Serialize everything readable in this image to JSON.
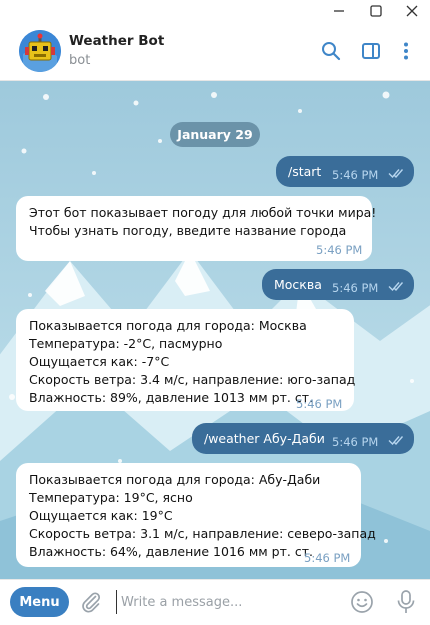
{
  "chat": {
    "title": "Weather Bot",
    "subtitle": "bot"
  },
  "date_separator": "January 29",
  "messages": [
    {
      "direction": "outgoing",
      "lines": [
        "/start"
      ],
      "time": "5:46 PM",
      "read": true
    },
    {
      "direction": "incoming",
      "lines": [
        "Этот бот показывает погоду для любой точки мира!",
        "Чтобы узнать погоду, введите название города"
      ],
      "time": "5:46 PM"
    },
    {
      "direction": "outgoing",
      "lines": [
        "Москва"
      ],
      "time": "5:46 PM",
      "read": true
    },
    {
      "direction": "incoming",
      "lines": [
        "Показывается погода для города: Москва",
        "Температура: -2°C, пасмурно",
        "Ощущается как: -7°C",
        "Скорость ветра: 3.4 м/с, направление: юго-запад",
        "Влажность: 89%, давление 1013 мм рт. ст."
      ],
      "time": "5:46 PM"
    },
    {
      "direction": "outgoing",
      "lines": [
        "/weather Абу-Даби"
      ],
      "time": "5:46 PM",
      "read": true
    },
    {
      "direction": "incoming",
      "lines": [
        "Показывается погода для города: Абу-Даби",
        "Температура:  19°C, ясно",
        "Ощущается как:  19°C",
        "Скорость ветра: 3.1 м/с, направление: северо-запад",
        "Влажность: 64%, давление 1016 мм рт. ст."
      ],
      "time": "5:46 PM"
    }
  ],
  "composer": {
    "menu_label": "Menu",
    "placeholder": "Write a message..."
  },
  "icons": {
    "window": [
      "minimize-icon",
      "maximize-icon",
      "close-icon"
    ],
    "header": [
      "search-icon",
      "sidebar-toggle-icon",
      "more-vertical-icon"
    ],
    "composer": [
      "paperclip-icon",
      "emoji-icon",
      "microphone-icon"
    ],
    "read_receipt": "double-check-icon"
  },
  "colors": {
    "outgoing_bubble": "#3a6d99",
    "incoming_bubble": "#ffffff",
    "accent": "#3a7fc1",
    "chat_background": "#a9cfe0"
  }
}
